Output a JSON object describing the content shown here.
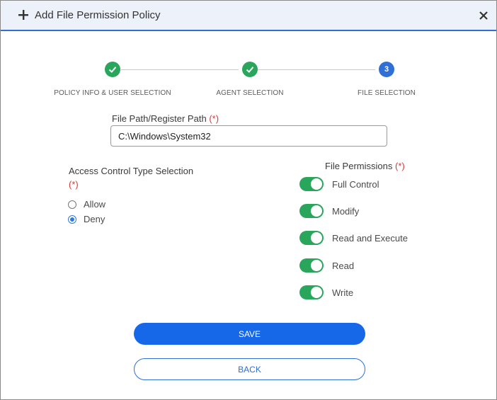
{
  "header": {
    "title": "Add File Permission Policy",
    "plus_icon": "plus-icon",
    "close_icon": "close-icon"
  },
  "stepper": {
    "steps": [
      {
        "label": "POLICY INFO & USER SELECTION",
        "state": "done"
      },
      {
        "label": "AGENT SELECTION",
        "state": "done"
      },
      {
        "label": "FILE SELECTION",
        "state": "active",
        "number": "3"
      }
    ],
    "done_color": "#2aa65c",
    "active_color": "#2f6fd6"
  },
  "file_path": {
    "label": "File Path/Register Path",
    "required_marker": "(*)",
    "value": "C:\\Windows\\System32"
  },
  "access_control": {
    "label": "Access Control Type Selection",
    "required_marker": "(*)",
    "options": [
      {
        "label": "Allow",
        "checked": false
      },
      {
        "label": "Deny",
        "checked": true
      }
    ]
  },
  "file_permissions": {
    "label": "File Permissions",
    "required_marker": "(*)",
    "items": [
      {
        "label": "Full Control",
        "enabled": true
      },
      {
        "label": "Modify",
        "enabled": true
      },
      {
        "label": "Read and Execute",
        "enabled": true
      },
      {
        "label": "Read",
        "enabled": true
      },
      {
        "label": "Write",
        "enabled": true
      }
    ],
    "toggle_color": "#2aa65c"
  },
  "buttons": {
    "save_label": "SAVE",
    "back_label": "BACK"
  }
}
